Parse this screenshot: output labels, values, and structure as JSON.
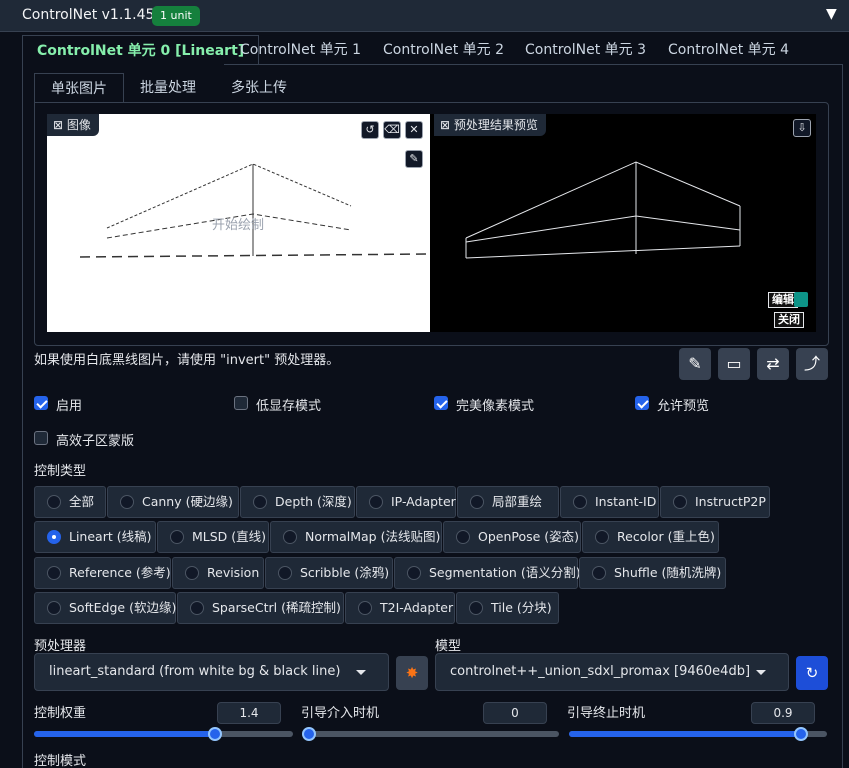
{
  "header": {
    "title": "ControlNet v1.1.455",
    "badge": "1 unit",
    "collapse_icon": "triangle-down-icon"
  },
  "unit_tabs": [
    {
      "label": "ControlNet 单元 0 [Lineart]",
      "active": true
    },
    {
      "label": "ControlNet 单元 1"
    },
    {
      "label": "ControlNet 单元 2"
    },
    {
      "label": "ControlNet 单元 3"
    },
    {
      "label": "ControlNet 单元 4"
    }
  ],
  "image_tabs": [
    {
      "label": "单张图片",
      "active": true
    },
    {
      "label": "批量处理"
    },
    {
      "label": "多张上传"
    }
  ],
  "input_image": {
    "label": "图像",
    "overlay_text": "开始绘制"
  },
  "preview_image": {
    "label": "预处理结果预览",
    "edit_label": "编辑",
    "close_label": "关闭"
  },
  "hint": "如果使用白底黑线图片，请使用 \"invert\" 预处理器。",
  "checkboxes": [
    {
      "label": "启用",
      "checked": true
    },
    {
      "label": "低显存模式",
      "checked": false
    },
    {
      "label": "完美像素模式",
      "checked": true
    },
    {
      "label": "允许预览",
      "checked": true
    },
    {
      "label": "高效子区蒙版",
      "checked": false
    }
  ],
  "control_type_label": "控制类型",
  "control_types": [
    "全部",
    "Canny (硬边缘)",
    "Depth (深度)",
    "IP-Adapter",
    "局部重绘",
    "Instant-ID",
    "InstructP2P",
    "Lineart (线稿)",
    "MLSD (直线)",
    "NormalMap (法线贴图)",
    "OpenPose (姿态)",
    "Recolor (重上色)",
    "Reference (参考)",
    "Revision",
    "Scribble (涂鸦)",
    "Segmentation (语义分割)",
    "Shuffle (随机洗牌)",
    "SoftEdge (软边缘)",
    "SparseCtrl (稀疏控制)",
    "T2I-Adapter",
    "Tile (分块)"
  ],
  "selected_control_type": "Lineart (线稿)",
  "preprocessor": {
    "label": "预处理器",
    "value": "lineart_standard (from white bg & black line)"
  },
  "model": {
    "label": "模型",
    "value": "controlnet++_union_sdxl_promax [9460e4db]"
  },
  "sliders": [
    {
      "label": "控制权重",
      "value": "1.4",
      "min": 0,
      "max": 2
    },
    {
      "label": "引导介入时机",
      "value": "0",
      "min": 0,
      "max": 1
    },
    {
      "label": "引导终止时机",
      "value": "0.9",
      "min": 0,
      "max": 1
    }
  ],
  "control_mode_label": "控制模式",
  "colors": {
    "accent": "#2563eb",
    "active_tab": "#86efac",
    "badge": "#15803d",
    "panel": "#1f2937",
    "background": "#0b0f19"
  }
}
